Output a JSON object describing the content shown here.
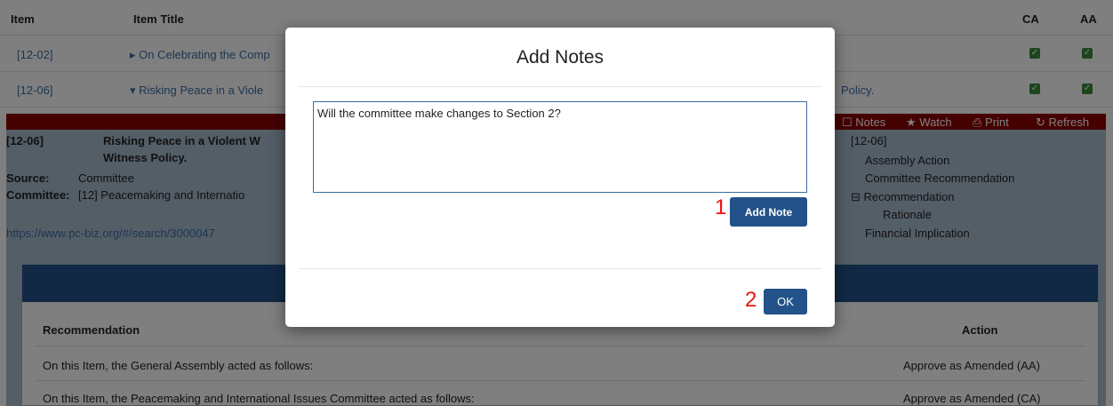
{
  "table": {
    "headers": {
      "item": "Item",
      "title": "Item Title",
      "ca": "CA",
      "aa": "AA"
    },
    "rows": [
      {
        "item": "[12-02]",
        "title": "▸ On Celebrating the Comp",
        "tail": ""
      },
      {
        "item": "[12-06]",
        "title": "▾ Risking Peace in a Viole",
        "tail": "Policy."
      }
    ]
  },
  "toolbar": {
    "notes": "Notes",
    "watch": "Watch",
    "print": "Print",
    "refresh": "Refresh"
  },
  "detail": {
    "number": "[12-06]",
    "title_line1": "Risking Peace in a Violent W",
    "title_line2": "Witness Policy.",
    "source_label": "Source:",
    "source_value": "Committee",
    "committee_label": "Committee:",
    "committee_value": "[12] Peacemaking and Internatio",
    "link": "https://www.pc-biz.org/#/search/3000047",
    "outline": {
      "number": "[12-06]",
      "assembly_action": "Assembly Action",
      "committee_recommendation": "Committee Recommendation",
      "recommendation": "Recommendation",
      "rationale": "Rationale",
      "financial_implication": "Financial Implication"
    }
  },
  "panel": {
    "col_recommendation": "Recommendation",
    "col_action": "Action",
    "rows": [
      {
        "text": "On this Item, the General Assembly acted as follows:",
        "action": "Approve as Amended (AA)"
      },
      {
        "text": "On this Item, the Peacemaking and International Issues Committee acted as follows:",
        "action": "Approve as Amended (CA)"
      }
    ]
  },
  "modal": {
    "title": "Add Notes",
    "note_text": "Will the committee make changes to Section 2?",
    "add_note_label": "Add Note",
    "ok_label": "OK",
    "step1": "1",
    "step2": "2"
  },
  "colors": {
    "accent": "#23528a",
    "banner": "#8b0000",
    "detail_bg": "#a8bccf",
    "checkbox": "#3d8b3d",
    "annotation": "#ee1111"
  },
  "icons": [
    "notes-icon",
    "star-icon",
    "print-icon",
    "refresh-icon",
    "checkbox-icon",
    "collapse-icon"
  ]
}
